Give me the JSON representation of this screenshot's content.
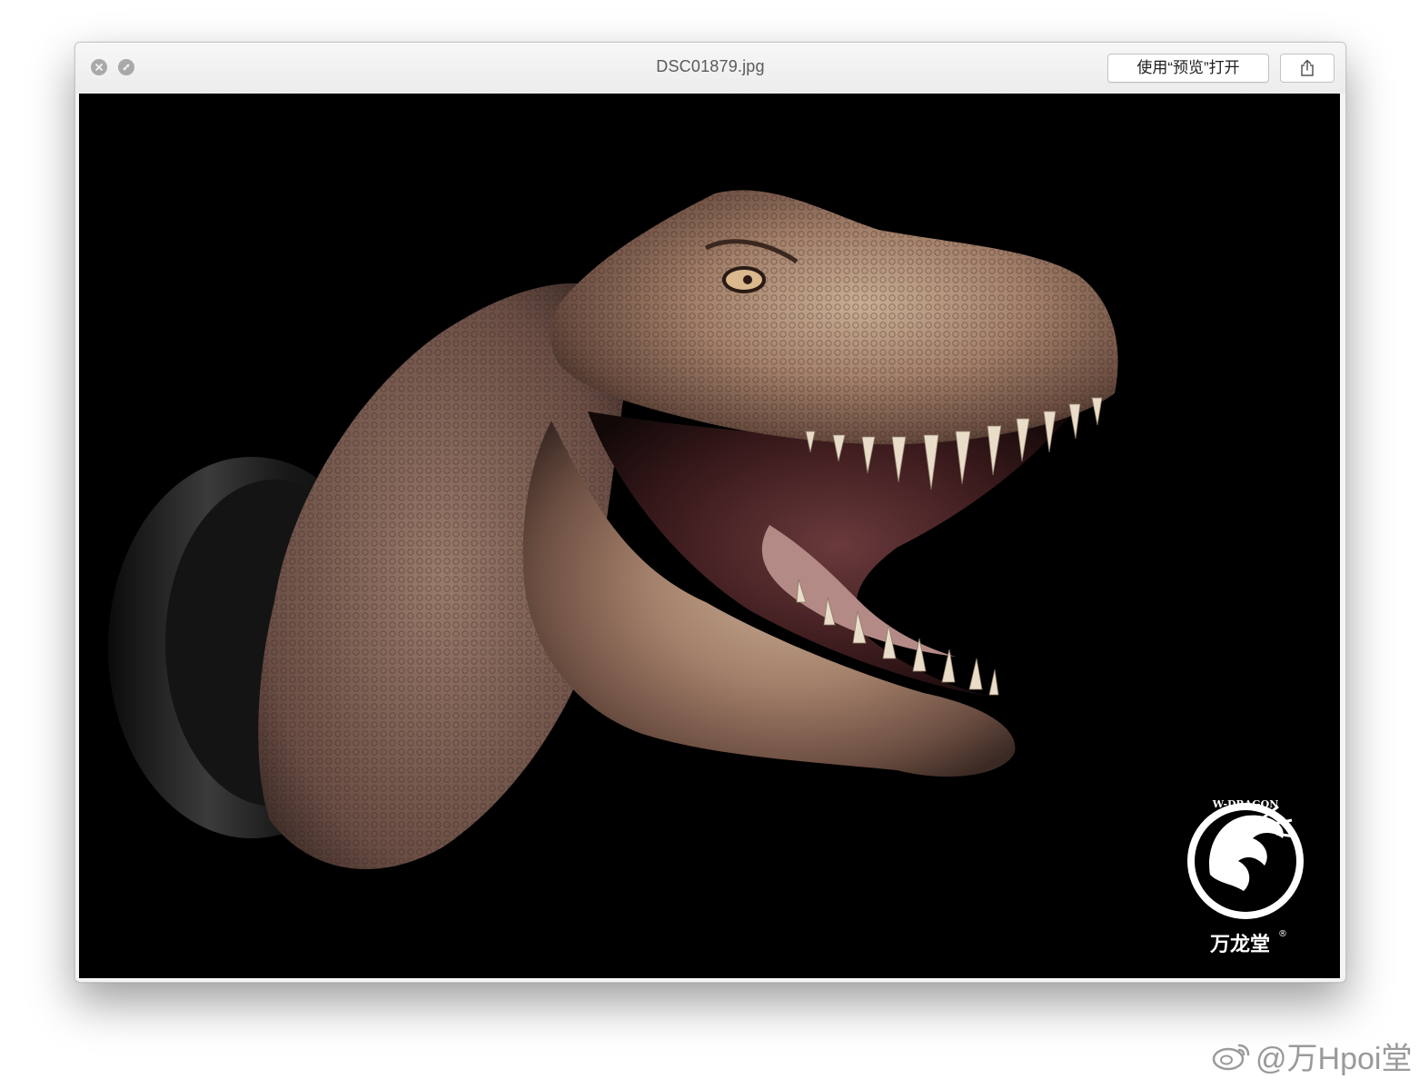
{
  "window": {
    "title": "DSC01879.jpg",
    "open_with_label": "使用“预览”打开",
    "share_icon": "share-icon",
    "close_icon": "close-icon",
    "fullscreen_icon": "fullscreen-icon"
  },
  "photo": {
    "subject": "tyrannosaurus-head-sculpture",
    "logo": {
      "arc_text": "W-DRAGON",
      "brand_cn": "万龙堂",
      "registered_mark": "®"
    }
  },
  "watermark": {
    "text": "@万Hpoi堂",
    "icon": "weibo-icon"
  }
}
